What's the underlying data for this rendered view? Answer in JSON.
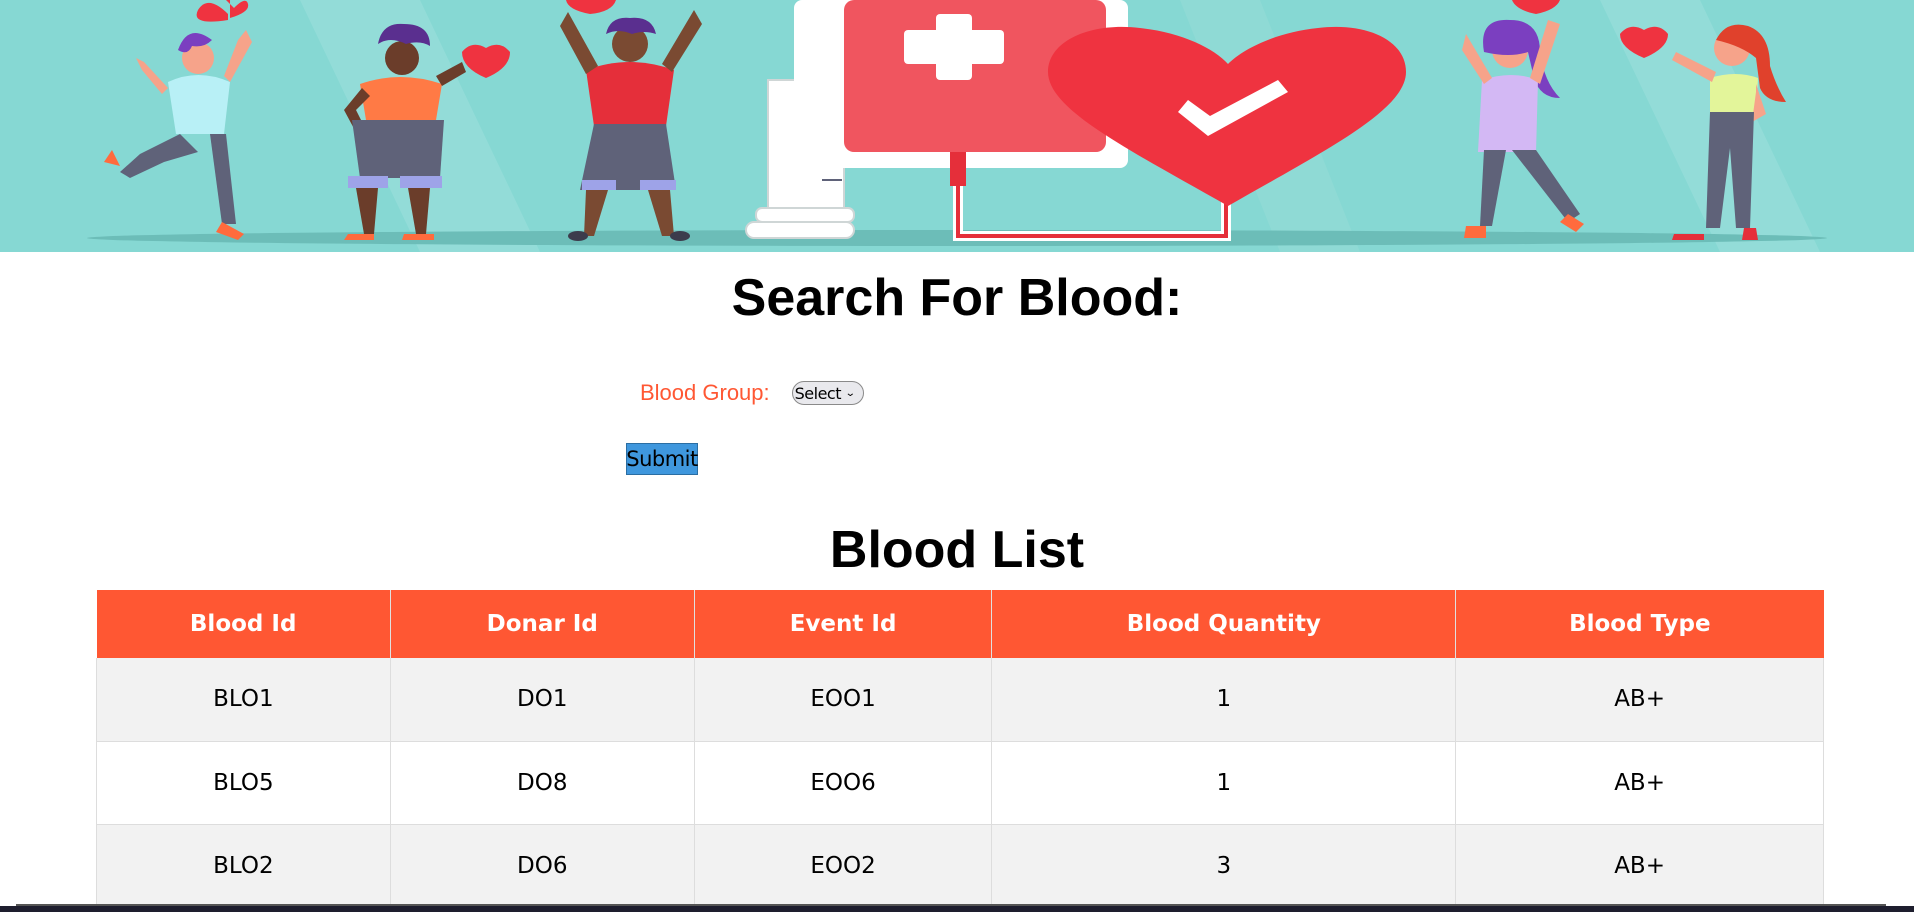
{
  "banner": {
    "alt": "Blood donation illustration"
  },
  "search": {
    "title": "Search For Blood:",
    "blood_group_label": "Blood Group:",
    "select_value": "Select",
    "submit_label": "Submit"
  },
  "list": {
    "title": "Blood List",
    "columns": [
      "Blood Id",
      "Donar Id",
      "Event Id",
      "Blood Quantity",
      "Blood Type"
    ],
    "rows": [
      [
        "BLO1",
        "DO1",
        "EOO1",
        "1",
        "AB+"
      ],
      [
        "BLO5",
        "DO8",
        "EOO6",
        "1",
        "AB+"
      ],
      [
        "BLO2",
        "DO6",
        "EOO2",
        "3",
        "AB+"
      ]
    ]
  },
  "colors": {
    "accent": "#ff5733",
    "banner_bg": "#86d8d3",
    "heart_red": "#ef3340",
    "submit_bg": "#3f97dd"
  }
}
